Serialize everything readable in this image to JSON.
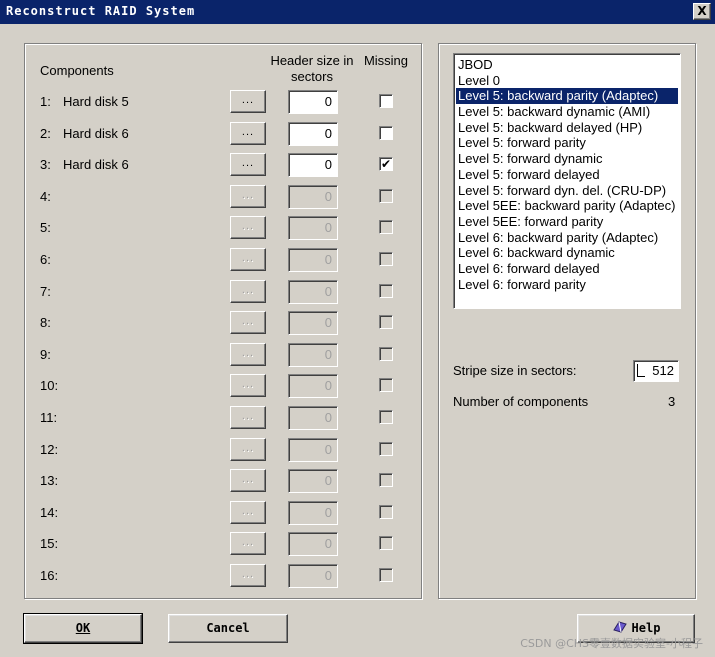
{
  "window": {
    "title": "Reconstruct RAID System",
    "close_label": "X"
  },
  "headers": {
    "components": "Components",
    "header_size": "Header size in sectors",
    "missing": "Missing"
  },
  "rows": [
    {
      "num": "1:",
      "name": "Hard disk 5",
      "size": "0",
      "missing": false,
      "enabled": true
    },
    {
      "num": "2:",
      "name": "Hard disk 6",
      "size": "0",
      "missing": false,
      "enabled": true
    },
    {
      "num": "3:",
      "name": "Hard disk 6",
      "size": "0",
      "missing": true,
      "enabled": true
    },
    {
      "num": "4:",
      "name": "",
      "size": "0",
      "missing": false,
      "enabled": false
    },
    {
      "num": "5:",
      "name": "",
      "size": "0",
      "missing": false,
      "enabled": false
    },
    {
      "num": "6:",
      "name": "",
      "size": "0",
      "missing": false,
      "enabled": false
    },
    {
      "num": "7:",
      "name": "",
      "size": "0",
      "missing": false,
      "enabled": false
    },
    {
      "num": "8:",
      "name": "",
      "size": "0",
      "missing": false,
      "enabled": false
    },
    {
      "num": "9:",
      "name": "",
      "size": "0",
      "missing": false,
      "enabled": false
    },
    {
      "num": "10:",
      "name": "",
      "size": "0",
      "missing": false,
      "enabled": false
    },
    {
      "num": "11:",
      "name": "",
      "size": "0",
      "missing": false,
      "enabled": false
    },
    {
      "num": "12:",
      "name": "",
      "size": "0",
      "missing": false,
      "enabled": false
    },
    {
      "num": "13:",
      "name": "",
      "size": "0",
      "missing": false,
      "enabled": false
    },
    {
      "num": "14:",
      "name": "",
      "size": "0",
      "missing": false,
      "enabled": false
    },
    {
      "num": "15:",
      "name": "",
      "size": "0",
      "missing": false,
      "enabled": false
    },
    {
      "num": "16:",
      "name": "",
      "size": "0",
      "missing": false,
      "enabled": false
    }
  ],
  "browse_label": "...",
  "check_mark": "✔",
  "raid_levels": [
    "JBOD",
    "Level 0",
    "Level 5: backward parity (Adaptec)",
    "Level 5: backward dynamic (AMI)",
    "Level 5: backward delayed (HP)",
    "Level 5: forward parity",
    "Level 5: forward dynamic",
    "Level 5: forward delayed",
    "Level 5: forward dyn. del. (CRU-DP)",
    "Level 5EE: backward parity (Adaptec)",
    "Level 5EE: forward parity",
    "Level 6: backward parity (Adaptec)",
    "Level 6: backward dynamic",
    "Level 6: forward delayed",
    "Level 6: forward parity"
  ],
  "selected_level": "Level 5: backward parity (Adaptec)",
  "stripe": {
    "label": "Stripe size in sectors:",
    "value": "512"
  },
  "num_components": {
    "label": "Number of components",
    "value": "3"
  },
  "buttons": {
    "ok": "OK",
    "cancel": "Cancel",
    "help": "Help"
  },
  "watermark": "CSDN @CHS零壹数据实验室-小程子",
  "colors": {
    "face": "#d4d0c8",
    "selection": "#0a246a",
    "disabled_text": "#a0a0a0"
  }
}
